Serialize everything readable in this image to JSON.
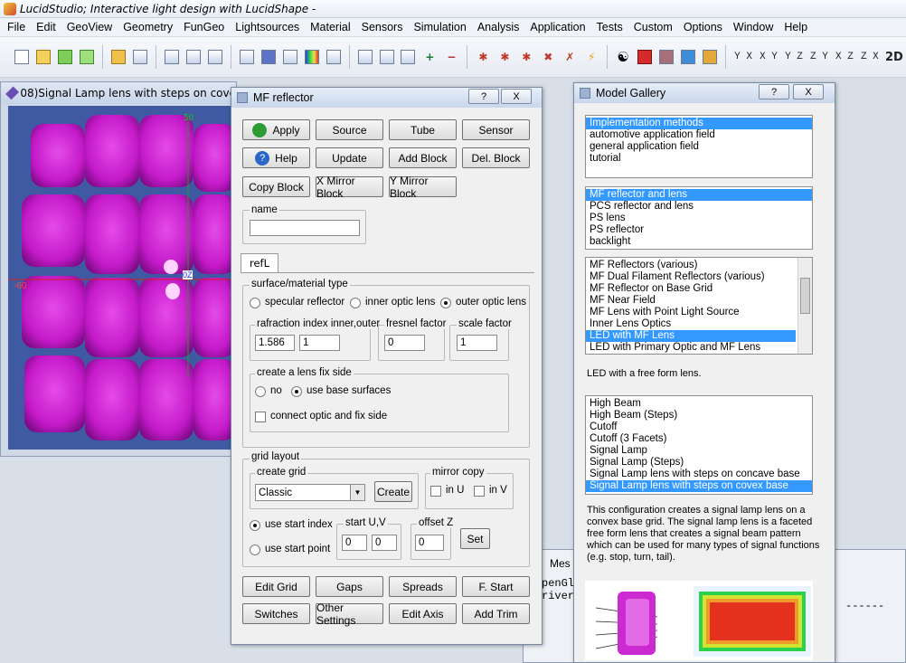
{
  "app": {
    "title": "LucidStudio; Interactive light design with LucidShape -"
  },
  "menu": [
    "File",
    "Edit",
    "GeoView",
    "Geometry",
    "FunGeo",
    "Lightsources",
    "Material",
    "Sensors",
    "Simulation",
    "Analysis",
    "Application",
    "Tests",
    "Custom",
    "Options",
    "Window",
    "Help"
  ],
  "toolbar": {
    "axis_labels": [
      "Y X",
      "X Y",
      "Y Z",
      "Z Y",
      "X Z",
      "Z X",
      "2D"
    ]
  },
  "view_window": {
    "title": "08)Signal Lamp lens with steps on cove",
    "axis_top": "50",
    "axis_left": "-60",
    "origin_label": "0Z"
  },
  "mf_dialog": {
    "title": "MF reflector",
    "help_btn": "?",
    "close_btn": "X",
    "buttons_row1": [
      "Apply",
      "Source",
      "Tube",
      "Sensor"
    ],
    "buttons_row2": [
      "Help",
      "Update",
      "Add Block",
      "Del. Block"
    ],
    "buttons_row3": [
      "Copy Block",
      "X Mirror Block",
      "Y Mirror Block"
    ],
    "name_label": "name",
    "name_value": "",
    "tab": "refL",
    "surface_group": "surface/material type",
    "surface_options": [
      "specular reflector",
      "inner optic lens",
      "outer optic lens"
    ],
    "refraction_label": "rafraction index inner,outer",
    "refraction_inner": "1.586",
    "refraction_outer": "1",
    "fresnel_label": "fresnel factor",
    "fresnel_value": "0",
    "scale_label": "scale factor",
    "scale_value": "1",
    "fix_side_group": "create a lens fix side",
    "fix_side_no": "no",
    "fix_side_base": "use base surfaces",
    "connect_label": "connect optic and fix side",
    "grid_group": "grid layout",
    "create_grid_label": "create grid",
    "create_grid_value": "Classic",
    "create_btn": "Create",
    "mirror_group": "mirror copy",
    "mirror_u": "in U",
    "mirror_v": "in V",
    "use_start_index": "use start index",
    "use_start_point": "use start point",
    "start_uv_label": "start U,V",
    "start_u": "0",
    "start_v": "0",
    "offset_label": "offset Z",
    "offset_value": "0",
    "set_btn": "Set",
    "bottom_row1": [
      "Edit Grid",
      "Gaps",
      "Spreads",
      "F. Start"
    ],
    "bottom_row2": [
      "Switches",
      "Other Settings",
      "Edit Axis",
      "Add Trim"
    ]
  },
  "gallery": {
    "title": "Model Gallery",
    "help_btn": "?",
    "close_btn": "X",
    "list1": [
      "Implementation methods",
      "automotive application field",
      "general application field",
      "tutorial"
    ],
    "list1_selected": 0,
    "list2": [
      "MF reflector and lens",
      "PCS reflector and lens",
      "PS lens",
      "PS reflector",
      "backlight"
    ],
    "list2_selected": 0,
    "list3": [
      "MF Reflectors (various)",
      "MF Dual Filament Reflectors (various)",
      "MF Reflector on Base Grid",
      "MF Near Field",
      "MF Lens with Point Light Source",
      "Inner Lens Optics",
      "LED with MF Lens",
      "LED with Primary Optic and MF Lens"
    ],
    "list3_selected": 6,
    "list3_desc": "LED with a free form lens.",
    "list4": [
      "High Beam",
      "High Beam (Steps)",
      "Cutoff",
      "Cutoff (3 Facets)",
      "Signal Lamp",
      "Signal Lamp (Steps)",
      "Signal Lamp lens with steps on concave base",
      "Signal Lamp lens with steps on covex base"
    ],
    "list4_selected": 7,
    "description": "This configuration creates a signal lamp lens on a convex base grid. The signal lamp lens is a faceted free form lens that creates a signal beam pattern which can be used for many types of signal functions (e.g. stop, turn, tail)."
  },
  "message_window": {
    "title": "Mes",
    "lines": [
      "penGl",
      "river"
    ],
    "dashes": "------"
  },
  "colors": {
    "lens": "#c81fd0",
    "canvas_bg": "#3f5aa2",
    "selection": "#3399ff"
  }
}
